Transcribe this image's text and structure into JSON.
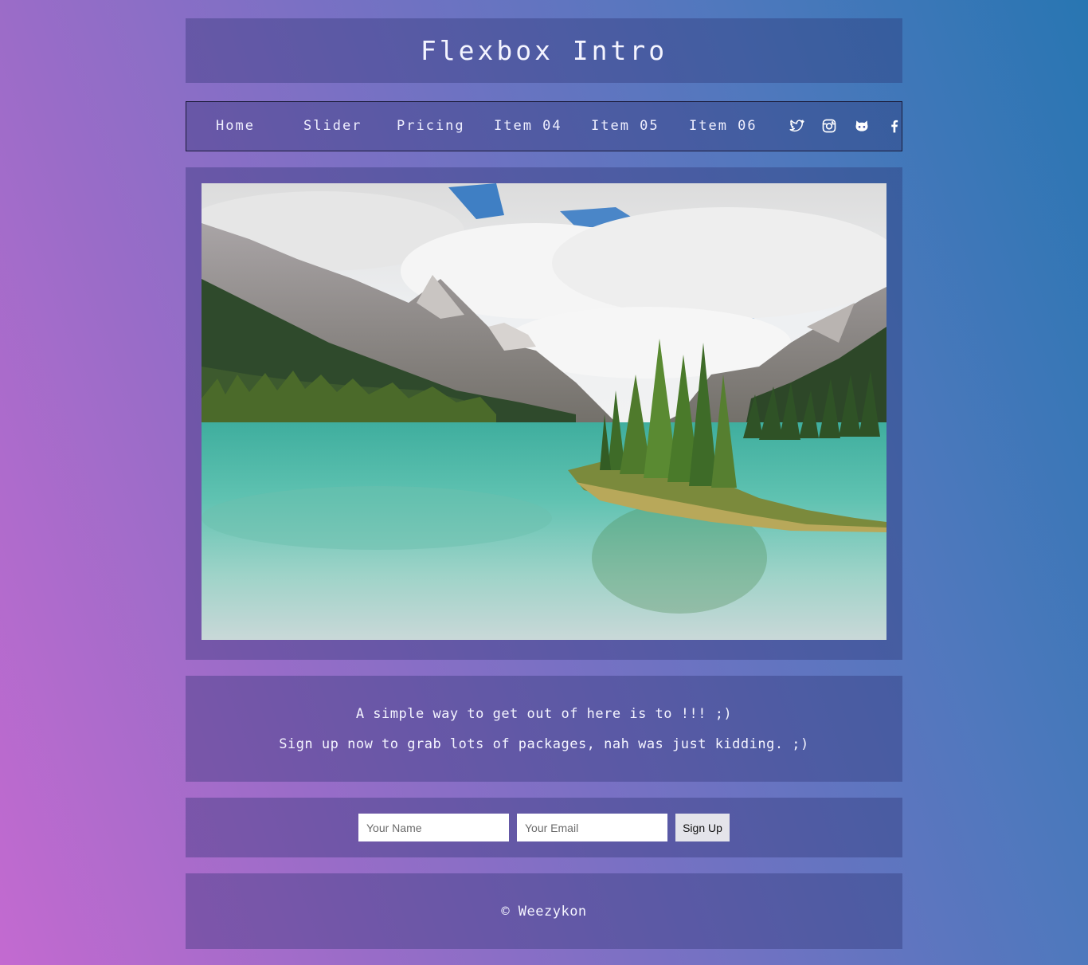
{
  "header": {
    "title": "Flexbox Intro"
  },
  "nav": {
    "items": [
      {
        "label": "Home"
      },
      {
        "label": "Slider"
      },
      {
        "label": "Pricing"
      },
      {
        "label": "Item 04"
      },
      {
        "label": "Item 05"
      },
      {
        "label": "Item 06"
      }
    ],
    "icons": [
      "twitter-icon",
      "instagram-icon",
      "github-icon",
      "facebook-icon"
    ]
  },
  "hero": {
    "image": "landscape photo of a turquoise mountain lake with a small tree-covered island, forested shores, rocky peaks and cloudy sky"
  },
  "message": {
    "line1": "A simple way to get out of here is to !!! ;)",
    "line2": "Sign up now to grab lots of packages, nah was just kidding. ;)"
  },
  "form": {
    "name_placeholder": "Your Name",
    "email_placeholder": "Your Email",
    "submit_label": "Sign Up"
  },
  "footer": {
    "copyright": "© Weezykon"
  },
  "colors": {
    "gradient_start": "#c36ad0",
    "gradient_end": "#2876b2",
    "panel": "rgba(40,45,110,0.35)"
  }
}
